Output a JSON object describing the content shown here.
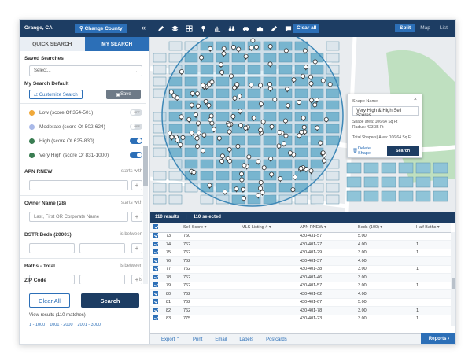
{
  "topbar": {
    "location": "Orange, CA",
    "change_county": "Change County",
    "collapse": "«",
    "tools": [
      "pencil-icon",
      "layers-icon",
      "grid-icon",
      "pin-icon",
      "chart-icon",
      "binoculars-icon",
      "car-icon",
      "house-people-icon",
      "ruler-icon",
      "comment-icon"
    ],
    "clear_all": "Clear all",
    "views": [
      "Split",
      "Map",
      "List"
    ],
    "active_view": "Split"
  },
  "sidebar": {
    "tabs": [
      "QUICK SEARCH",
      "MY SEARCH"
    ],
    "saved_searches_label": "Saved Searches",
    "select_value": "Select...",
    "default_label": "My Search Default",
    "customize_label": "Customize Search",
    "save_label": "Save",
    "scores": [
      {
        "label": "Low (score Of 354-501)",
        "color": "#f0a93b",
        "toggle": "off",
        "toggle_text": "OFF"
      },
      {
        "label": "Moderate (score Of 502-624)",
        "color": "#a9b9e8",
        "toggle": "off",
        "toggle_text": "OFF"
      },
      {
        "label": "High (score Of 625-830)",
        "color": "#3a7d52",
        "toggle": "on",
        "toggle_text": "ON"
      },
      {
        "label": "Very High (score Of 831-1000)",
        "color": "#3a7d52",
        "toggle": "on",
        "toggle_text": "ON"
      }
    ],
    "fields": {
      "apn": {
        "label": "APN RNEW",
        "op": "starts with"
      },
      "owner": {
        "label": "Owner Name (28)",
        "op": "starts with",
        "placeholder": "Last, First OR Corporate Name"
      },
      "beds": {
        "label": "DSTR Beds (20001)",
        "op": "is between"
      },
      "baths": {
        "label": "Baths - Total",
        "op": "is between"
      },
      "zip": {
        "label": "ZIP Code",
        "op": "is"
      }
    },
    "clear_all": "Clear All",
    "search": "Search",
    "view_results": "View results (110 matches)",
    "pages": [
      "1 - 1000",
      "1001 - 2000",
      "2001 - 3000"
    ]
  },
  "map": {
    "popup": {
      "title": "Shape Name",
      "close": "×",
      "name_value": "Very High & High Sell Scores",
      "area": "Shape area: 106.64 Sq Ft",
      "radius": "Radius: 423.35 Ft",
      "total": "Total Shape(s) Area: 106.64 Sq Ft",
      "delete": "Delete Shape",
      "search": "Search"
    }
  },
  "results": {
    "count": "110 results",
    "selected": "110 selected",
    "columns": [
      "",
      "",
      "Sell Score ▾",
      "MLS Listing # ▾",
      "APN RNEW ▾",
      "Beds (100) ▾",
      "Half Baths ▾"
    ],
    "rows": [
      [
        "73",
        "760",
        "",
        "430-431-57",
        "5.00",
        ""
      ],
      [
        "74",
        "762",
        "",
        "430-401-27",
        "4.00",
        "1"
      ],
      [
        "75",
        "762",
        "",
        "430-401-29",
        "3.00",
        "1"
      ],
      [
        "76",
        "762",
        "",
        "430-401-37",
        "4.00",
        ""
      ],
      [
        "77",
        "762",
        "",
        "430-401-38",
        "3.00",
        "1"
      ],
      [
        "78",
        "762",
        "",
        "430-401-46",
        "3.00",
        ""
      ],
      [
        "79",
        "762",
        "",
        "430-401-57",
        "3.00",
        "1"
      ],
      [
        "80",
        "762",
        "",
        "430-401-62",
        "4.00",
        ""
      ],
      [
        "81",
        "762",
        "",
        "430-401-67",
        "5.00",
        ""
      ],
      [
        "82",
        "762",
        "",
        "430-401-78",
        "3.00",
        "1"
      ],
      [
        "83",
        "775",
        "",
        "430-401-23",
        "3.00",
        "1"
      ]
    ],
    "footer_links": [
      "Export ⌃",
      "Print",
      "Email",
      "Labels",
      "Postcards"
    ],
    "reports": "Reports ›"
  },
  "colors": {
    "nav": "#1d3d63",
    "accent": "#2c6fb7",
    "parcel_fill": "#8fc4d8",
    "circle_stroke": "#3e88b7",
    "park": "#bfe0c0"
  }
}
